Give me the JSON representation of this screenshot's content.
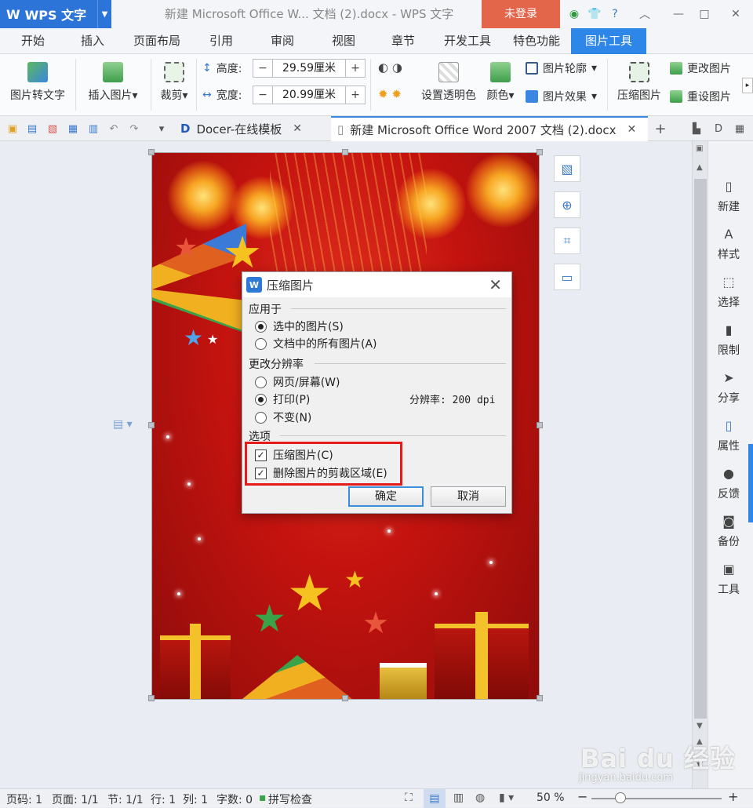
{
  "app": {
    "logo": "W",
    "name": "WPS 文字",
    "doc_title": "新建 Microsoft Office W... 文档 (2).docx - WPS 文字",
    "login": "未登录"
  },
  "ribbon_tabs": [
    "开始",
    "插入",
    "页面布局",
    "引用",
    "审阅",
    "视图",
    "章节",
    "开发工具",
    "特色功能",
    "图片工具"
  ],
  "ribbon": {
    "pic_to_text": "图片转文字",
    "insert_pic": "插入图片",
    "crop": "裁剪",
    "height_label": "高度:",
    "height_value": "29.59厘米",
    "width_label": "宽度:",
    "width_value": "20.99厘米",
    "set_transparent": "设置透明色",
    "color": "颜色",
    "outline": "图片轮廓",
    "effects": "图片效果",
    "compress": "压缩图片",
    "change_pic": "更改图片",
    "reset_pic": "重设图片"
  },
  "doc_tabs": [
    {
      "label": "Docer-在线模板"
    },
    {
      "label": "新建 Microsoft Office Word 2007 文档 (2).docx"
    }
  ],
  "right_panel": [
    "新建",
    "样式",
    "选择",
    "限制",
    "分享",
    "属性",
    "反馈",
    "备份",
    "工具"
  ],
  "dialog": {
    "title": "压缩图片",
    "apply_group": "应用于",
    "apply_selected": "选中的图片(S)",
    "apply_all": "文档中的所有图片(A)",
    "resolution_group": "更改分辨率",
    "res_web": "网页/屏幕(W)",
    "res_print": "打印(P)",
    "res_keep": "不变(N)",
    "resolution_text": "分辨率: 200 dpi",
    "options_group": "选项",
    "opt_compress": "压缩图片(C)",
    "opt_delete_crop": "删除图片的剪裁区域(E)",
    "ok": "确定",
    "cancel": "取消"
  },
  "status": {
    "page_no": "页码: 1",
    "pages": "页面: 1/1",
    "section": "节: 1/1",
    "row": "行: 1",
    "col": "列: 1",
    "words": "字数: 0",
    "spell": "拼写检查",
    "zoom": "50 %"
  },
  "watermark": {
    "main": "Bai du 经验",
    "sub": "jingyan.baidu.com"
  }
}
